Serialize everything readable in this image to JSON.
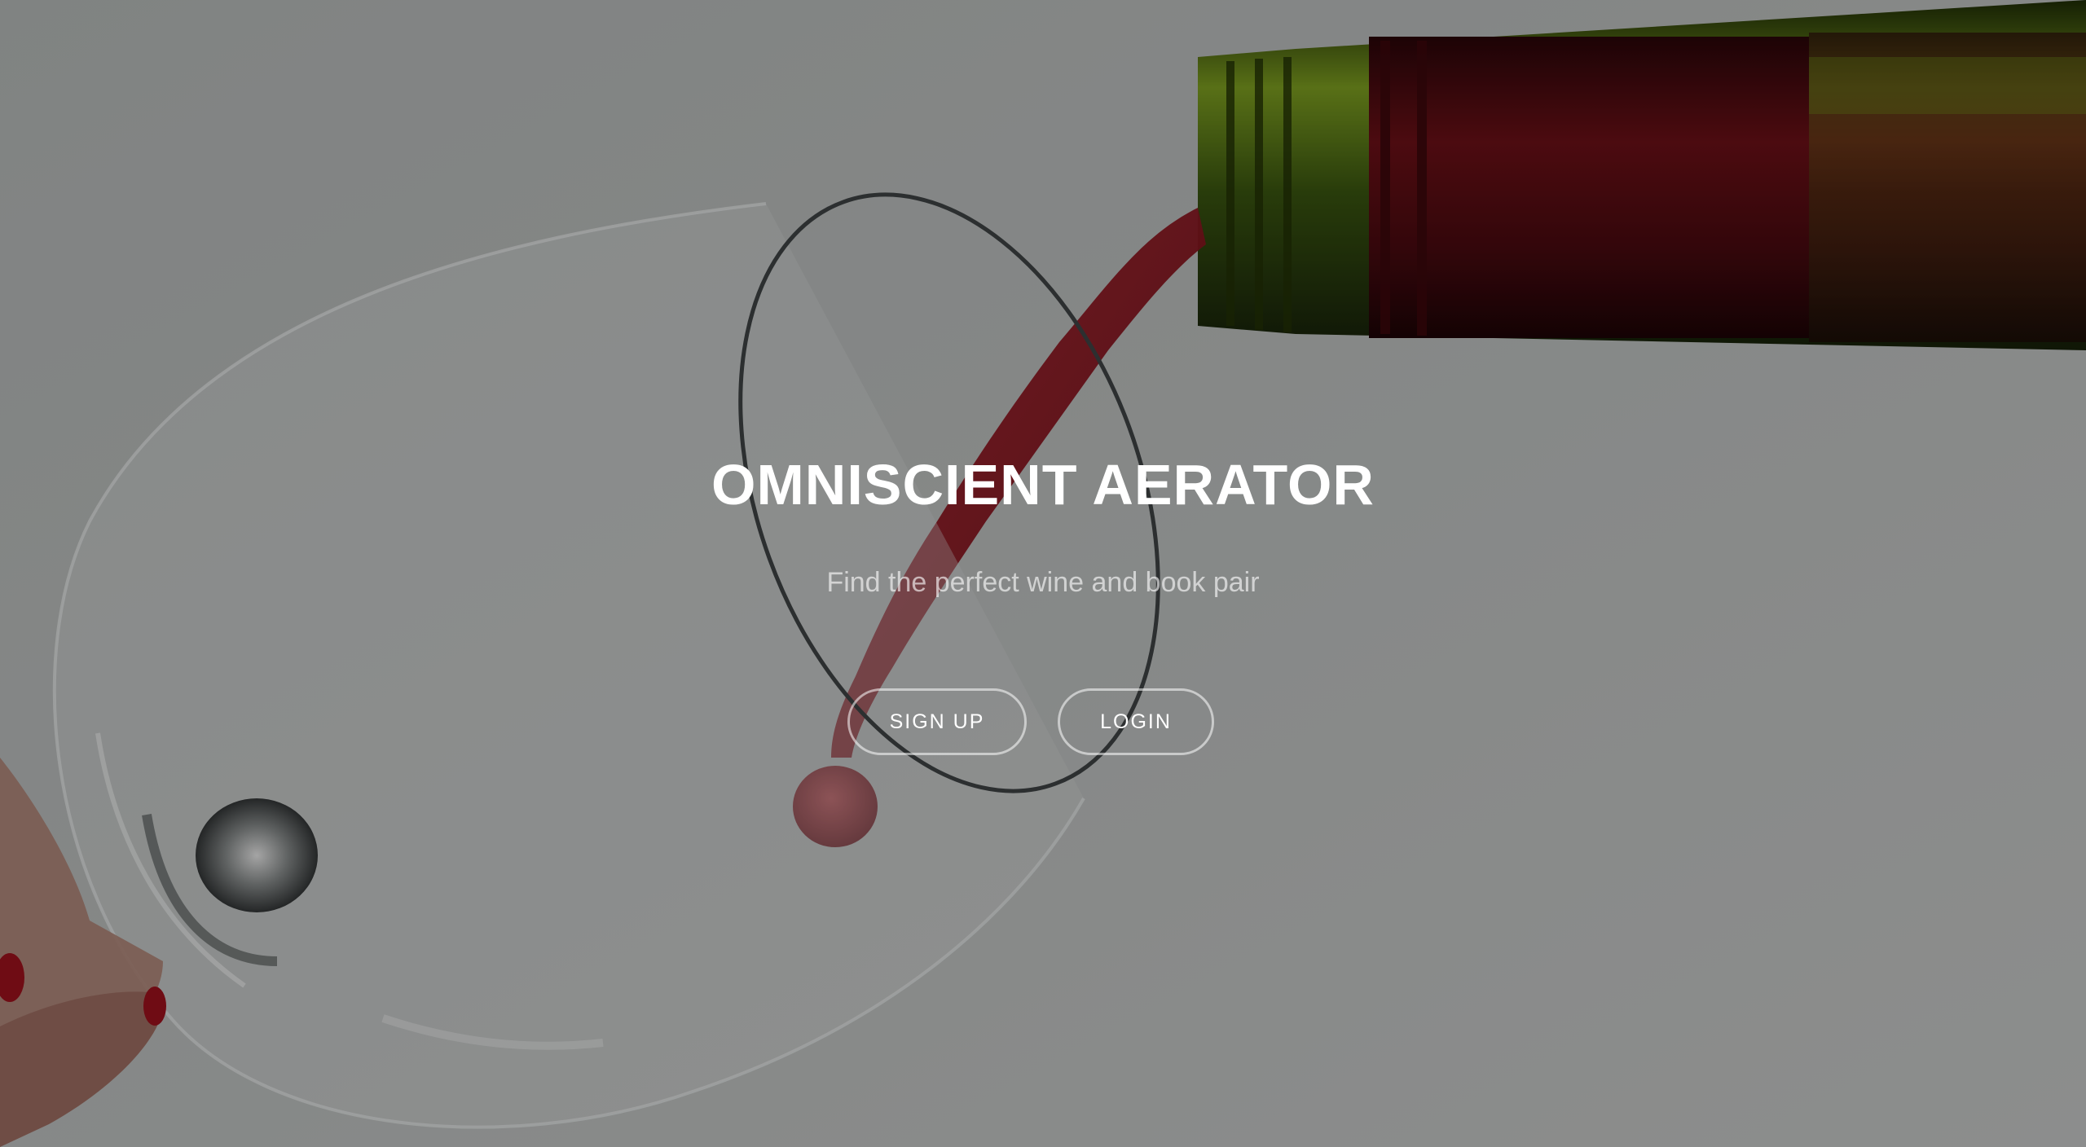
{
  "hero": {
    "title": "OMNISCIENT AERATOR",
    "subtitle": "Find the perfect wine and book pair",
    "buttons": {
      "signup_label": "SIGN UP",
      "login_label": "LOGIN"
    }
  },
  "colors": {
    "overlay": "#000000",
    "text": "#ffffff",
    "wine": "#8a1620",
    "bottle_green": "#4d6b12"
  }
}
